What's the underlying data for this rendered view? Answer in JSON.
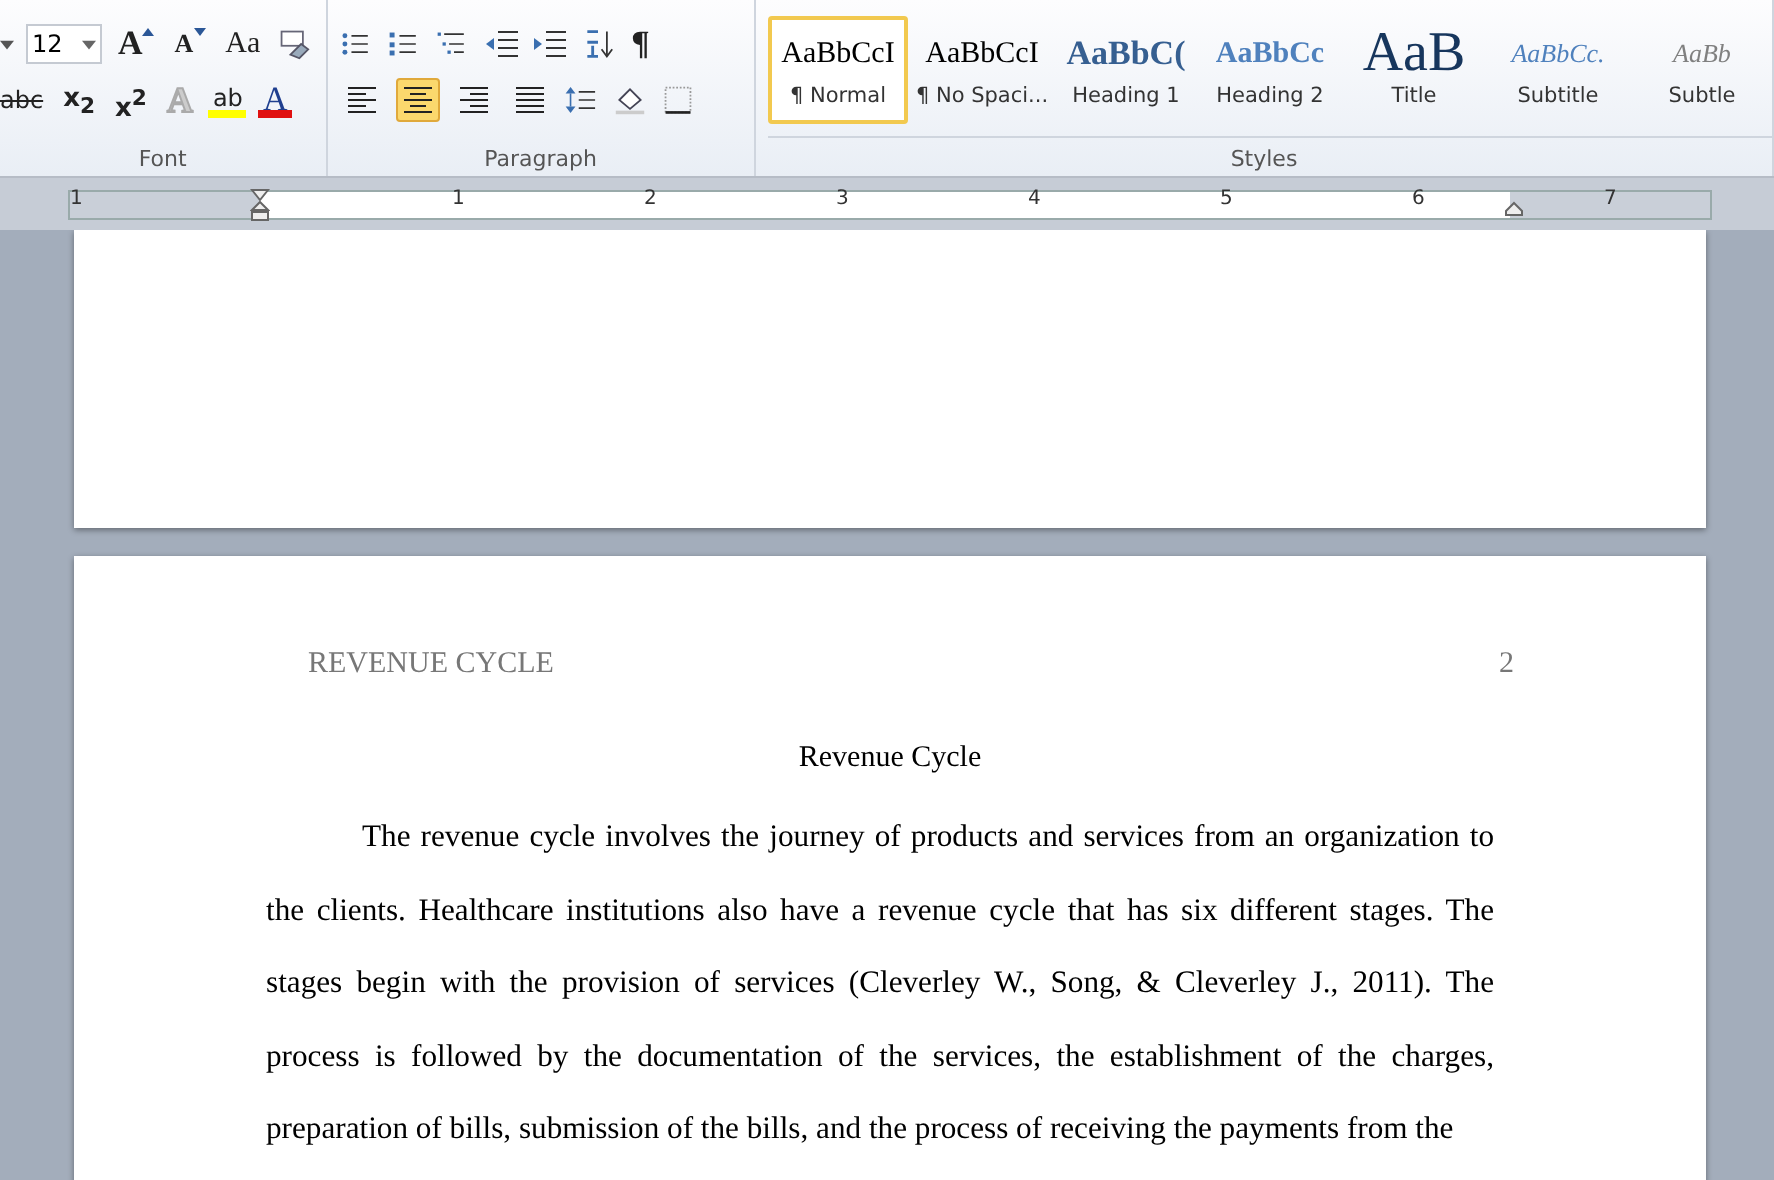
{
  "ribbon": {
    "font": {
      "label": "Font",
      "size": "12",
      "grow": "A",
      "shrink": "A",
      "change_case": "Aa",
      "strike": "abc",
      "subscript": "x$_{2}$",
      "superscript": "x$^{2}$",
      "effects": "A",
      "highlight": "ab",
      "font_color": "A"
    },
    "paragraph": {
      "label": "Paragraph",
      "pilcrow": "¶",
      "alignments": [
        {
          "kind": "left",
          "selected": false
        },
        {
          "kind": "center",
          "selected": true
        },
        {
          "kind": "right",
          "selected": false
        },
        {
          "kind": "justify",
          "selected": false
        }
      ]
    },
    "styles": {
      "label": "Styles",
      "items": [
        {
          "preview": "AaBbCcI",
          "name": "¶ Normal",
          "kind": "normal",
          "selected": true
        },
        {
          "preview": "AaBbCcI",
          "name": "¶ No Spaci...",
          "kind": "normal",
          "selected": false
        },
        {
          "preview": "AaBbC(",
          "name": "Heading 1",
          "kind": "heading1",
          "selected": false
        },
        {
          "preview": "AaBbCc",
          "name": "Heading 2",
          "kind": "heading2",
          "selected": false
        },
        {
          "preview": "AaB",
          "name": "Title",
          "kind": "title",
          "selected": false
        },
        {
          "preview": "AaBbCc.",
          "name": "Subtitle",
          "kind": "subtitle",
          "selected": false
        },
        {
          "preview": "AaBb",
          "name": "Subtle",
          "kind": "subtle",
          "selected": false
        }
      ]
    }
  },
  "ruler": {
    "numbers": [
      "1",
      "1",
      "2",
      "3",
      "4",
      "5",
      "6",
      "7"
    ]
  },
  "page": {
    "header": "REVENUE CYCLE",
    "page_number": "2",
    "title": "Revenue Cycle",
    "paragraph": "The revenue cycle involves the journey of products and services from an organization to the clients. Healthcare institutions also have a revenue cycle that has six different stages. The stages begin with the provision of services (Cleverley W., Song, & Cleverley J., 2011). The process is followed by the documentation of the services, the establishment of the charges, preparation of bills, submission of the bills, and the process of receiving the payments from the"
  }
}
